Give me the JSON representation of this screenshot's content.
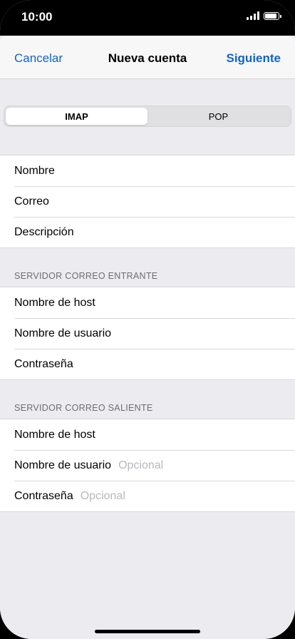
{
  "status_bar": {
    "time": "10:00",
    "icons": [
      "signal-icon",
      "battery-icon"
    ]
  },
  "navbar": {
    "cancel_label": "Cancelar",
    "title": "Nueva cuenta",
    "next_label": "Siguiente"
  },
  "segmented": {
    "options": [
      "IMAP",
      "POP"
    ],
    "selected": "IMAP"
  },
  "account": {
    "fields": [
      {
        "label": "Nombre"
      },
      {
        "label": "Correo"
      },
      {
        "label": "Descripción"
      }
    ]
  },
  "incoming": {
    "header": "SERVIDOR CORREO ENTRANTE",
    "fields": [
      {
        "label": "Nombre de host"
      },
      {
        "label": "Nombre de usuario"
      },
      {
        "label": "Contraseña"
      }
    ]
  },
  "outgoing": {
    "header": "SERVIDOR CORREO SALIENTE",
    "fields": [
      {
        "label": "Nombre de host"
      },
      {
        "label": "Nombre de usuario",
        "placeholder": "Opcional"
      },
      {
        "label": "Contraseña",
        "placeholder": "Opcional"
      }
    ]
  },
  "colors": {
    "accent": "#1066c4",
    "background": "#ebebf0",
    "placeholder": "#b9b9bd"
  }
}
